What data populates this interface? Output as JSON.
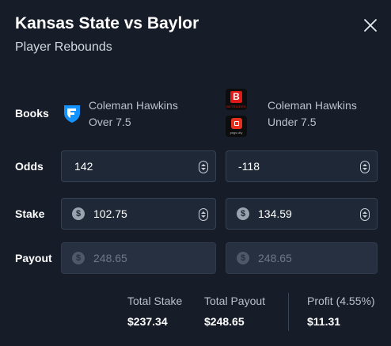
{
  "header": {
    "title": "Kansas State vs Baylor",
    "subtitle": "Player Rebounds"
  },
  "rows": {
    "books": "Books",
    "odds": "Odds",
    "stake": "Stake",
    "payout": "Payout"
  },
  "left": {
    "book_logo": "fanduel-logo",
    "player": "Coleman Hawkins",
    "line": "Over 7.5",
    "odds": "142",
    "stake": "102.75",
    "payout": "248.65"
  },
  "right": {
    "book_logos": [
      {
        "name": "betrivers-logo",
        "text": "BETRIVERS"
      },
      {
        "name": "play-sugarhouse-logo",
        "text": "pngs city"
      }
    ],
    "player": "Coleman Hawkins",
    "line": "Under 7.5",
    "odds": "-118",
    "stake": "134.59",
    "payout": "248.65"
  },
  "summary": {
    "total_stake_label": "Total Stake",
    "total_stake": "$237.34",
    "total_payout_label": "Total Payout",
    "total_payout": "$248.65",
    "profit_label": "Profit (4.55%)",
    "profit": "$11.31"
  },
  "icons": {
    "close": "close-icon",
    "currency": "$",
    "stepper": "stepper-icon"
  }
}
